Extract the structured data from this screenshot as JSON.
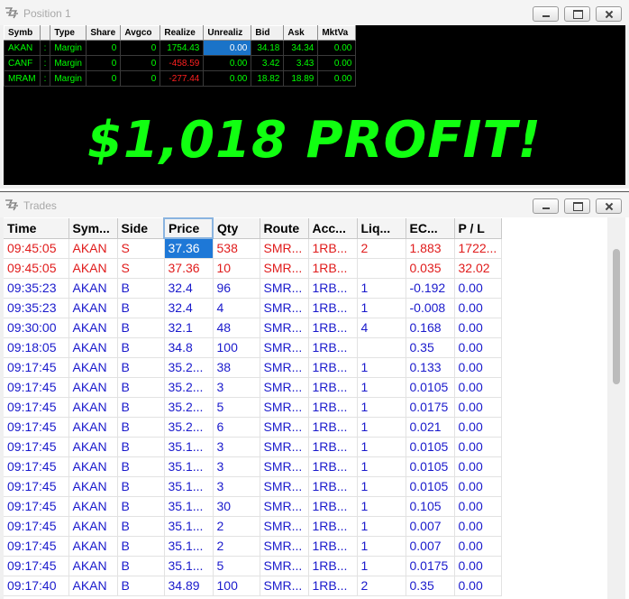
{
  "position_window": {
    "title": "Position 1",
    "columns": [
      "Symb",
      "",
      "Type",
      "Share",
      "Avgco",
      "Realize",
      "Unrealiz",
      "Bid",
      "Ask",
      "MktVa"
    ],
    "rows": [
      {
        "symbol": "AKAN",
        "sep": ":",
        "type": "Margin",
        "shares": "0",
        "avgcost": "0",
        "realized": "1754.43",
        "unrealized": "0.00",
        "bid": "34.18",
        "ask": "34.34",
        "mktval": "0.00",
        "realized_color": "#00ff00"
      },
      {
        "symbol": "CANF",
        "sep": ":",
        "type": "Margin",
        "shares": "0",
        "avgcost": "0",
        "realized": "-458.59",
        "unrealized": "0.00",
        "bid": "3.42",
        "ask": "3.43",
        "mktval": "0.00",
        "realized_color": "#ff2020"
      },
      {
        "symbol": "MRAM",
        "sep": ":",
        "type": "Margin",
        "shares": "0",
        "avgcost": "0",
        "realized": "-277.44",
        "unrealized": "0.00",
        "bid": "18.82",
        "ask": "18.89",
        "mktval": "0.00",
        "realized_color": "#ff2020"
      }
    ],
    "profit_banner": "$1,018 PROFIT!"
  },
  "trades_window": {
    "title": "Trades",
    "columns": [
      "Time",
      "Sym...",
      "Side",
      "Price",
      "Qty",
      "Route",
      "Acc...",
      "Liq...",
      "EC...",
      "P / L"
    ],
    "rows": [
      {
        "time": "09:45:05",
        "sym": "AKAN",
        "side": "S",
        "price": "37.36",
        "qty": "538",
        "route": "SMR...",
        "acc": "1RB...",
        "liq": "2",
        "ec": "1.883",
        "pl": "1722...",
        "color": "red"
      },
      {
        "time": "09:45:05",
        "sym": "AKAN",
        "side": "S",
        "price": "37.36",
        "qty": "10",
        "route": "SMR...",
        "acc": "1RB...",
        "liq": "",
        "ec": "0.035",
        "pl": "32.02",
        "color": "red"
      },
      {
        "time": "09:35:23",
        "sym": "AKAN",
        "side": "B",
        "price": "32.4",
        "qty": "96",
        "route": "SMR...",
        "acc": "1RB...",
        "liq": "1",
        "ec": "-0.192",
        "pl": "0.00",
        "color": "blue"
      },
      {
        "time": "09:35:23",
        "sym": "AKAN",
        "side": "B",
        "price": "32.4",
        "qty": "4",
        "route": "SMR...",
        "acc": "1RB...",
        "liq": "1",
        "ec": "-0.008",
        "pl": "0.00",
        "color": "blue"
      },
      {
        "time": "09:30:00",
        "sym": "AKAN",
        "side": "B",
        "price": "32.1",
        "qty": "48",
        "route": "SMR...",
        "acc": "1RB...",
        "liq": "4",
        "ec": "0.168",
        "pl": "0.00",
        "color": "blue"
      },
      {
        "time": "09:18:05",
        "sym": "AKAN",
        "side": "B",
        "price": "34.8",
        "qty": "100",
        "route": "SMR...",
        "acc": "1RB...",
        "liq": "",
        "ec": "0.35",
        "pl": "0.00",
        "color": "blue"
      },
      {
        "time": "09:17:45",
        "sym": "AKAN",
        "side": "B",
        "price": "35.2...",
        "qty": "38",
        "route": "SMR...",
        "acc": "1RB...",
        "liq": "1",
        "ec": "0.133",
        "pl": "0.00",
        "color": "blue"
      },
      {
        "time": "09:17:45",
        "sym": "AKAN",
        "side": "B",
        "price": "35.2...",
        "qty": "3",
        "route": "SMR...",
        "acc": "1RB...",
        "liq": "1",
        "ec": "0.0105",
        "pl": "0.00",
        "color": "blue"
      },
      {
        "time": "09:17:45",
        "sym": "AKAN",
        "side": "B",
        "price": "35.2...",
        "qty": "5",
        "route": "SMR...",
        "acc": "1RB...",
        "liq": "1",
        "ec": "0.0175",
        "pl": "0.00",
        "color": "blue"
      },
      {
        "time": "09:17:45",
        "sym": "AKAN",
        "side": "B",
        "price": "35.2...",
        "qty": "6",
        "route": "SMR...",
        "acc": "1RB...",
        "liq": "1",
        "ec": "0.021",
        "pl": "0.00",
        "color": "blue"
      },
      {
        "time": "09:17:45",
        "sym": "AKAN",
        "side": "B",
        "price": "35.1...",
        "qty": "3",
        "route": "SMR...",
        "acc": "1RB...",
        "liq": "1",
        "ec": "0.0105",
        "pl": "0.00",
        "color": "blue"
      },
      {
        "time": "09:17:45",
        "sym": "AKAN",
        "side": "B",
        "price": "35.1...",
        "qty": "3",
        "route": "SMR...",
        "acc": "1RB...",
        "liq": "1",
        "ec": "0.0105",
        "pl": "0.00",
        "color": "blue"
      },
      {
        "time": "09:17:45",
        "sym": "AKAN",
        "side": "B",
        "price": "35.1...",
        "qty": "3",
        "route": "SMR...",
        "acc": "1RB...",
        "liq": "1",
        "ec": "0.0105",
        "pl": "0.00",
        "color": "blue"
      },
      {
        "time": "09:17:45",
        "sym": "AKAN",
        "side": "B",
        "price": "35.1...",
        "qty": "30",
        "route": "SMR...",
        "acc": "1RB...",
        "liq": "1",
        "ec": "0.105",
        "pl": "0.00",
        "color": "blue"
      },
      {
        "time": "09:17:45",
        "sym": "AKAN",
        "side": "B",
        "price": "35.1...",
        "qty": "2",
        "route": "SMR...",
        "acc": "1RB...",
        "liq": "1",
        "ec": "0.007",
        "pl": "0.00",
        "color": "blue"
      },
      {
        "time": "09:17:45",
        "sym": "AKAN",
        "side": "B",
        "price": "35.1...",
        "qty": "2",
        "route": "SMR...",
        "acc": "1RB...",
        "liq": "1",
        "ec": "0.007",
        "pl": "0.00",
        "color": "blue"
      },
      {
        "time": "09:17:45",
        "sym": "AKAN",
        "side": "B",
        "price": "35.1...",
        "qty": "5",
        "route": "SMR...",
        "acc": "1RB...",
        "liq": "1",
        "ec": "0.0175",
        "pl": "0.00",
        "color": "blue"
      },
      {
        "time": "09:17:40",
        "sym": "AKAN",
        "side": "B",
        "price": "34.89",
        "qty": "100",
        "route": "SMR...",
        "acc": "1RB...",
        "liq": "2",
        "ec": "0.35",
        "pl": "0.00",
        "color": "blue"
      }
    ]
  },
  "icons": {
    "window_icon": "window-icon",
    "minimize": "minimize-icon",
    "maximize": "maximize-icon",
    "close": "close-icon"
  },
  "colors": {
    "profit_green": "#11ff11",
    "gain_green": "#00ff00",
    "loss_red": "#ff2020",
    "sell_red": "#e01b1b",
    "buy_blue": "#1a1acc",
    "selection_blue": "#1e78d7"
  }
}
